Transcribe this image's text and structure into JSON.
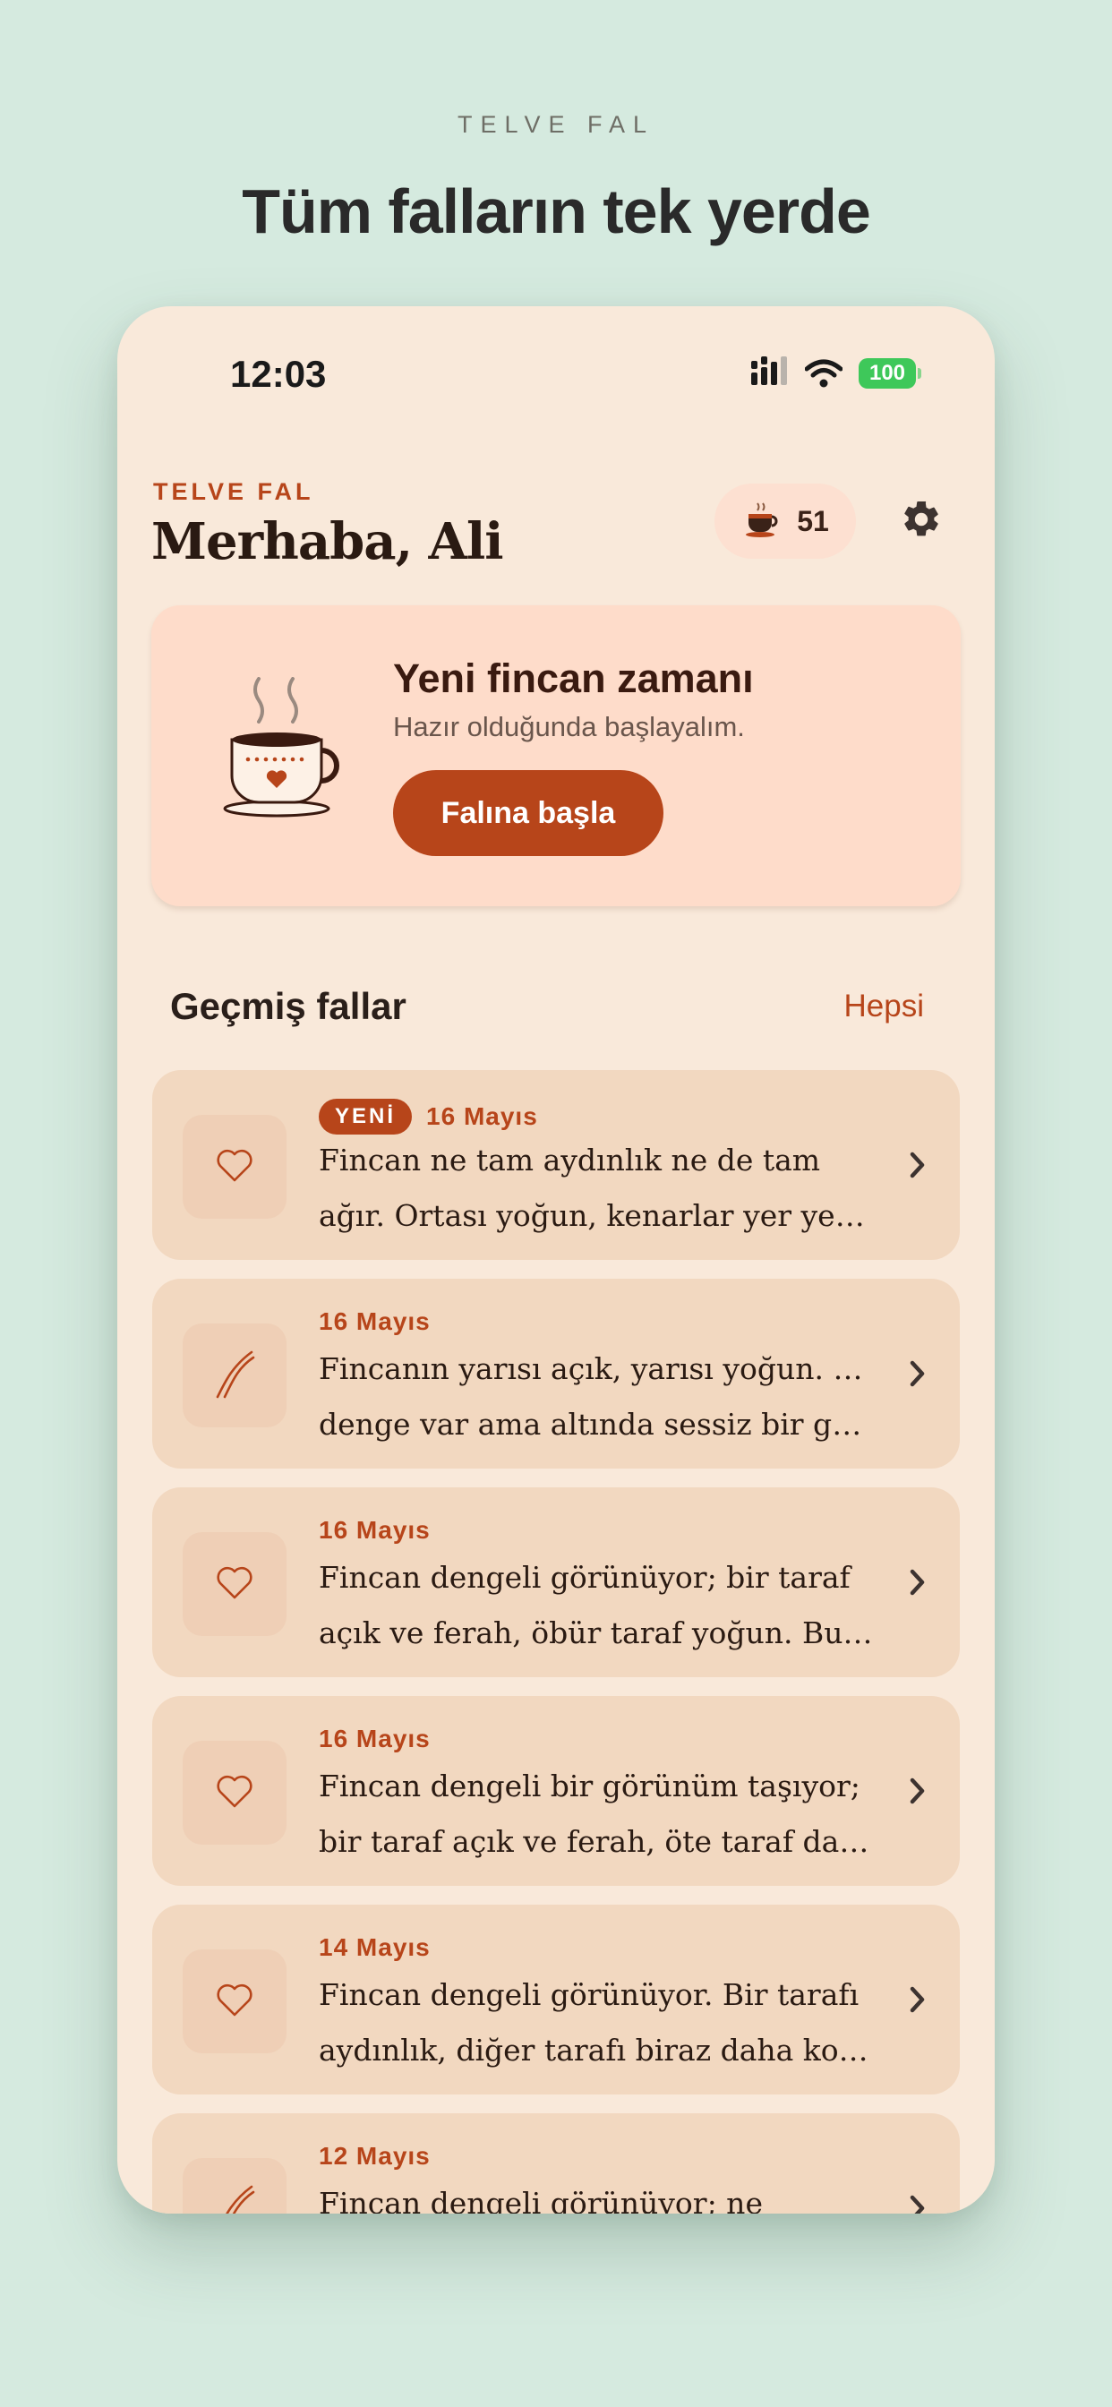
{
  "page": {
    "brand": "TELVE FAL",
    "headline": "Tüm falların tek yerde"
  },
  "status_bar": {
    "time": "12:03",
    "battery": "100"
  },
  "header": {
    "app_label": "TELVE FAL",
    "greeting": "Merhaba, Ali",
    "coin_count": "51",
    "coin_icon": "coffee-cup-icon",
    "settings_icon": "gear-icon"
  },
  "hero": {
    "title": "Yeni fincan zamanı",
    "subtitle": "Hazır olduğunda başlayalım.",
    "button_label": "Falına başla"
  },
  "history": {
    "title": "Geçmiş fallar",
    "see_all": "Hepsi",
    "items": [
      {
        "badge": "YENİ",
        "date": "16 Mayıs",
        "icon": "heart-icon",
        "line1": "Fincan ne tam aydınlık ne de tam",
        "line2": "ağır. Ortası yoğun, kenarlar yer yer ..."
      },
      {
        "badge": "",
        "date": "16 Mayıs",
        "icon": "path-icon",
        "line1": "Fincanın yarısı açık, yarısı yoğun. Bir",
        "line2": "denge var ama altında sessiz bir ger..."
      },
      {
        "badge": "",
        "date": "16 Mayıs",
        "icon": "heart-icon",
        "line1": "Fincan dengeli görünüyor; bir taraf",
        "line2": "açık ve ferah, öbür taraf yoğun. Bu, ..."
      },
      {
        "badge": "",
        "date": "16 Mayıs",
        "icon": "heart-icon",
        "line1": "Fincan dengeli bir görünüm taşıyor;",
        "line2": "bir taraf açık ve ferah, öte taraf dah..."
      },
      {
        "badge": "",
        "date": "14 Mayıs",
        "icon": "heart-icon",
        "line1": "Fincan dengeli görünüyor. Bir tarafı",
        "line2": "aydınlık, diğer tarafı biraz daha koy..."
      },
      {
        "badge": "",
        "date": "12 Mayıs",
        "icon": "path-icon",
        "line1": "Fincan dengeli görünüyor; ne",
        "line2": ""
      }
    ]
  },
  "colors": {
    "background": "#d5eadf",
    "phone": "#f9e9da",
    "accent": "#b7451a",
    "hero": "#fedcca",
    "card": "#f2d8c0"
  }
}
